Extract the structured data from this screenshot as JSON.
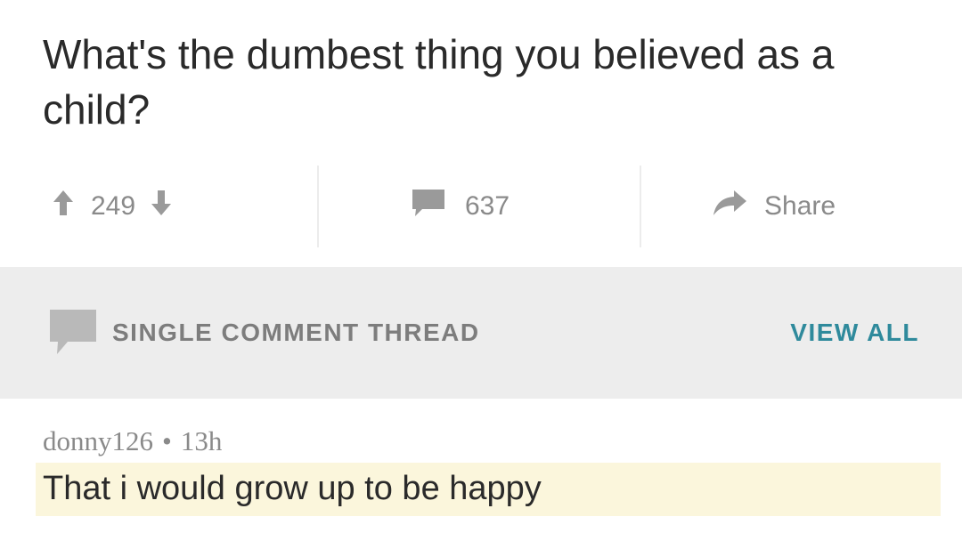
{
  "post": {
    "title": "What's the dumbest thing you believed as a child?"
  },
  "actions": {
    "upvotes": "249",
    "comments": "637",
    "share_label": "Share"
  },
  "thread": {
    "label": "SINGLE COMMENT THREAD",
    "view_all": "VIEW ALL"
  },
  "comment": {
    "author": "donny126",
    "separator": "•",
    "age": "13h",
    "body": "That i would grow up to be happy"
  },
  "colors": {
    "accent": "#2f8a9c",
    "highlight": "#fbf6dc",
    "thread_bar": "#ededed",
    "muted": "#8a8a8a"
  }
}
